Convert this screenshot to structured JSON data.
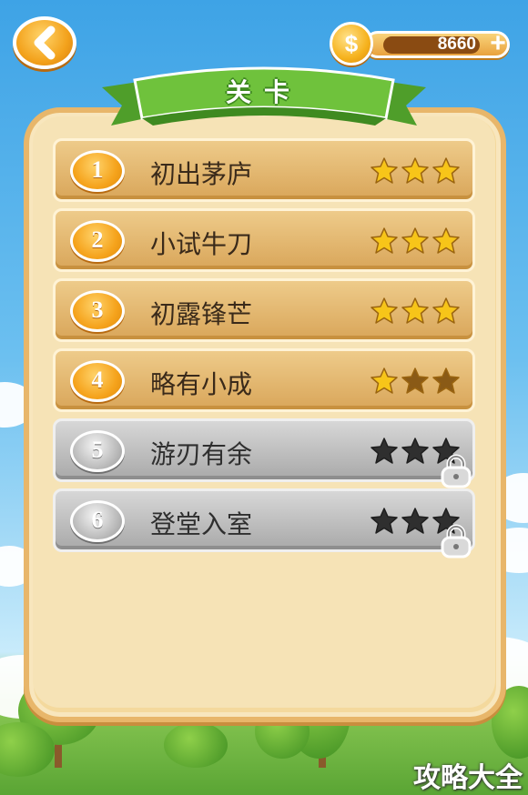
{
  "header": {
    "title": "关卡",
    "coins": "8660",
    "coin_symbol": "$",
    "plus_label": "+"
  },
  "levels": [
    {
      "number": "1",
      "name": "初出茅庐",
      "stars": 3,
      "locked": false
    },
    {
      "number": "2",
      "name": "小试牛刀",
      "stars": 3,
      "locked": false
    },
    {
      "number": "3",
      "name": "初露锋芒",
      "stars": 3,
      "locked": false
    },
    {
      "number": "4",
      "name": "略有小成",
      "stars": 1,
      "locked": false
    },
    {
      "number": "5",
      "name": "游刃有余",
      "stars": 0,
      "locked": true
    },
    {
      "number": "6",
      "name": "登堂入室",
      "stars": 0,
      "locked": true
    }
  ],
  "colors": {
    "star_gold": "#f7c519",
    "star_empty": "#8a5a16",
    "star_locked": "#2f2f2f",
    "ribbon_green": "#6fc23c"
  },
  "watermark": "攻略大全"
}
